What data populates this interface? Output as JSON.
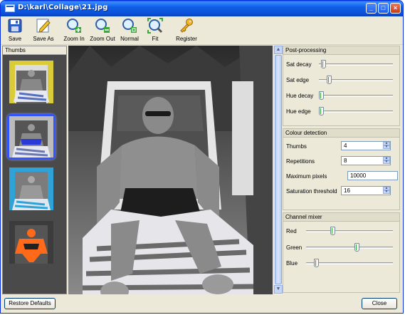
{
  "window": {
    "title": "D:\\karl\\Collage\\21.jpg",
    "controls": [
      "_",
      "□",
      "×"
    ]
  },
  "toolbar": {
    "items": [
      {
        "label": "Save",
        "icon": "floppy-icon"
      },
      {
        "label": "Save As",
        "icon": "save-as-icon"
      },
      {
        "label": "Zoom In",
        "icon": "zoom-in-icon"
      },
      {
        "label": "Zoom Out",
        "icon": "zoom-out-icon"
      },
      {
        "label": "Normal",
        "icon": "zoom-normal-icon"
      },
      {
        "label": "Fit",
        "icon": "zoom-fit-icon"
      },
      {
        "label": "Register",
        "icon": "key-icon"
      }
    ]
  },
  "thumbs": {
    "title": "Thumbs",
    "selected_index": 1
  },
  "post_processing": {
    "title": "Post-processing",
    "sliders": [
      {
        "label": "Sat decay",
        "value": 0.03
      },
      {
        "label": "Sat edge",
        "value": 0.12
      },
      {
        "label": "Hue decay",
        "value": 0.0
      },
      {
        "label": "Hue edge",
        "value": 0.0
      }
    ]
  },
  "colour_detection": {
    "title": "Colour detection",
    "fields": [
      {
        "label": "Thumbs",
        "value": "4"
      },
      {
        "label": "Repetitions",
        "value": "8"
      },
      {
        "label": "Maximum pixels",
        "value": "10000"
      },
      {
        "label": "Saturation threshold",
        "value": "16"
      }
    ]
  },
  "channel_mixer": {
    "title": "Channel mixer",
    "sliders": [
      {
        "label": "Red",
        "value": 0.3
      },
      {
        "label": "Green",
        "value": 0.6
      },
      {
        "label": "Blue",
        "value": 0.1
      }
    ]
  },
  "footer": {
    "restore_label": "Restore Defaults",
    "close_label": "Close"
  },
  "colors": {
    "titlebar": "#0b4fd8",
    "selection": "#3355ff"
  }
}
